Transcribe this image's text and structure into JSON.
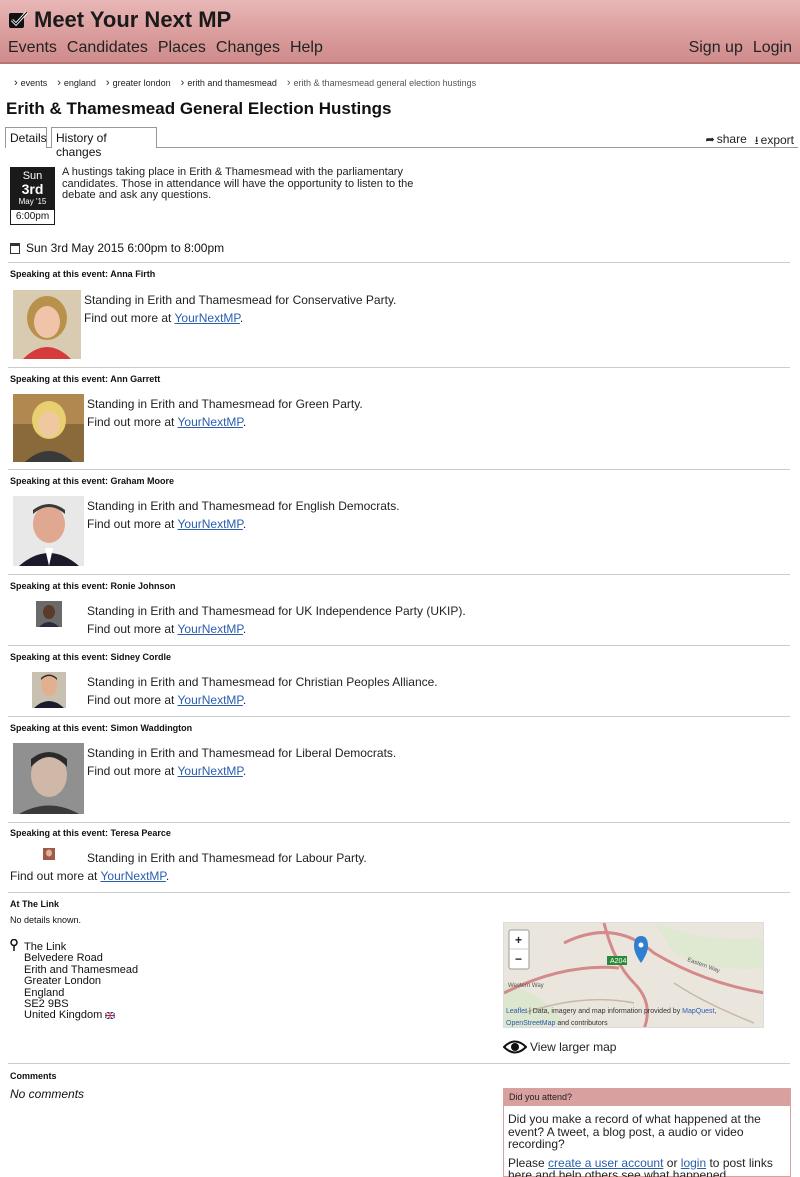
{
  "header": {
    "title": "Meet Your Next MP",
    "nav": [
      "Events",
      "Candidates",
      "Places",
      "Changes",
      "Help"
    ],
    "sign_up": "Sign up",
    "login": "Login"
  },
  "breadcrumb": [
    "events",
    "england",
    "greater london",
    "erith and thamesmead",
    "erith & thamesmead general election hustings"
  ],
  "page": {
    "title": "Erith & Thamesmead General Election Hustings",
    "tabs": [
      "Details",
      "History of changes"
    ],
    "share": "share",
    "export": "export"
  },
  "event": {
    "day": "Sun",
    "date": "3rd",
    "month": "May '15",
    "time": "6:00pm",
    "description": "A hustings taking place in Erith & Thamesmead with the parliamentary candidates. Those in attendance will have the opportunity to listen to the debate and ask any questions.",
    "when": "Sun 3rd May 2015 6:00pm to 8:00pm"
  },
  "speakers": [
    {
      "heading": "Speaking at this event: Anna Firth",
      "standing": "Standing in Erith and Thamesmead for Conservative Party.",
      "find_prefix": "Find out more at ",
      "link": "YourNextMP",
      "suffix": "."
    },
    {
      "heading": "Speaking at this event: Ann Garrett",
      "standing": "Standing in Erith and Thamesmead for Green Party.",
      "find_prefix": "Find out more at ",
      "link": "YourNextMP",
      "suffix": "."
    },
    {
      "heading": "Speaking at this event: Graham Moore",
      "standing": "Standing in Erith and Thamesmead for English Democrats.",
      "find_prefix": "Find out more at ",
      "link": "YourNextMP",
      "suffix": "."
    },
    {
      "heading": "Speaking at this event: Ronie Johnson",
      "standing": "Standing in Erith and Thamesmead for UK Independence Party (UKIP).",
      "find_prefix": "Find out more at ",
      "link": "YourNextMP",
      "suffix": "."
    },
    {
      "heading": "Speaking at this event: Sidney Cordle",
      "standing": "Standing in Erith and Thamesmead for Christian Peoples Alliance.",
      "find_prefix": "Find out more at ",
      "link": "YourNextMP",
      "suffix": "."
    },
    {
      "heading": "Speaking at this event: Simon Waddington",
      "standing": "Standing in Erith and Thamesmead for Liberal Democrats.",
      "find_prefix": "Find out more at ",
      "link": "YourNextMP",
      "suffix": "."
    },
    {
      "heading": "Speaking at this event: Teresa Pearce",
      "standing": "Standing in Erith and Thamesmead for Labour Party.",
      "find_prefix": "Find out more at ",
      "link": "YourNextMP",
      "suffix": "."
    }
  ],
  "venue": {
    "heading": "At The Link",
    "details": "No details known.",
    "address": [
      "The Link",
      "Belvedere Road",
      "Erith and Thamesmead",
      "Greater London",
      "England",
      "SE2 9BS",
      "United Kingdom"
    ]
  },
  "map": {
    "zoom_in": "+",
    "zoom_out": "−",
    "road_label": "A204",
    "street_label_1": "Western Way",
    "street_label_2": "Eastern Way",
    "attrib_leaflet": "Leaflet",
    "attrib_text": " | Data, imagery and map information provided by ",
    "attrib_mapquest": "MapQuest",
    "attrib_sep": ",",
    "attrib_osm": "OpenStreetMap",
    "attrib_end": " and contributors",
    "view_larger": "View larger map"
  },
  "comments": {
    "heading": "Comments",
    "none": "No comments"
  },
  "attend": {
    "heading": "Did you attend?",
    "question": "Did you make a record of what happened at the event? A tweet, a blog post, a audio or video recording?",
    "please": "Please ",
    "create_account": "create a user account",
    "or": " or ",
    "login": "login",
    "rest": " to post links here and help others see what happened."
  },
  "colors": {
    "header": "#d99a9a",
    "link": "#2a5db0",
    "attend_head": "#d9a0a0"
  }
}
